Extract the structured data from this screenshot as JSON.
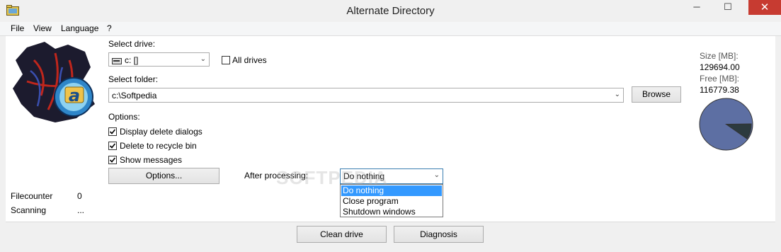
{
  "window": {
    "title": "Alternate Directory",
    "minimize_glyph": "─",
    "maximize_glyph": "☐",
    "close_glyph": "✕"
  },
  "menu": [
    "File",
    "View",
    "Language",
    "?"
  ],
  "drive": {
    "label": "Select drive:",
    "value": "c: []",
    "all_drives_label": "All drives",
    "all_drives_checked": false
  },
  "folder": {
    "label": "Select folder:",
    "value": "c:\\Softpedia",
    "browse_label": "Browse"
  },
  "options": {
    "heading": "Options:",
    "items": [
      {
        "label": "Display delete dialogs",
        "checked": true
      },
      {
        "label": "Delete to recycle bin",
        "checked": true
      },
      {
        "label": "Show messages",
        "checked": true
      }
    ],
    "button_label": "Options..."
  },
  "after_processing": {
    "label": "After processing:",
    "selected": "Do nothing",
    "list": [
      "Do nothing",
      "Close program",
      "Shutdown windows"
    ]
  },
  "stats": {
    "filecounter_label": "Filecounter",
    "filecounter_value": "0",
    "scanning_label": "Scanning",
    "scanning_value": "..."
  },
  "disk": {
    "size_label": "Size [MB]:",
    "size_value": "129694.00",
    "free_label": "Free [MB]:",
    "free_value": "116779.38",
    "pie_colors": {
      "free": "#5d6fa3",
      "used": "#2c3a3f"
    }
  },
  "footer": {
    "clean_label": "Clean drive",
    "diagnosis_label": "Diagnosis"
  },
  "watermark": "SOFTPEDIA"
}
